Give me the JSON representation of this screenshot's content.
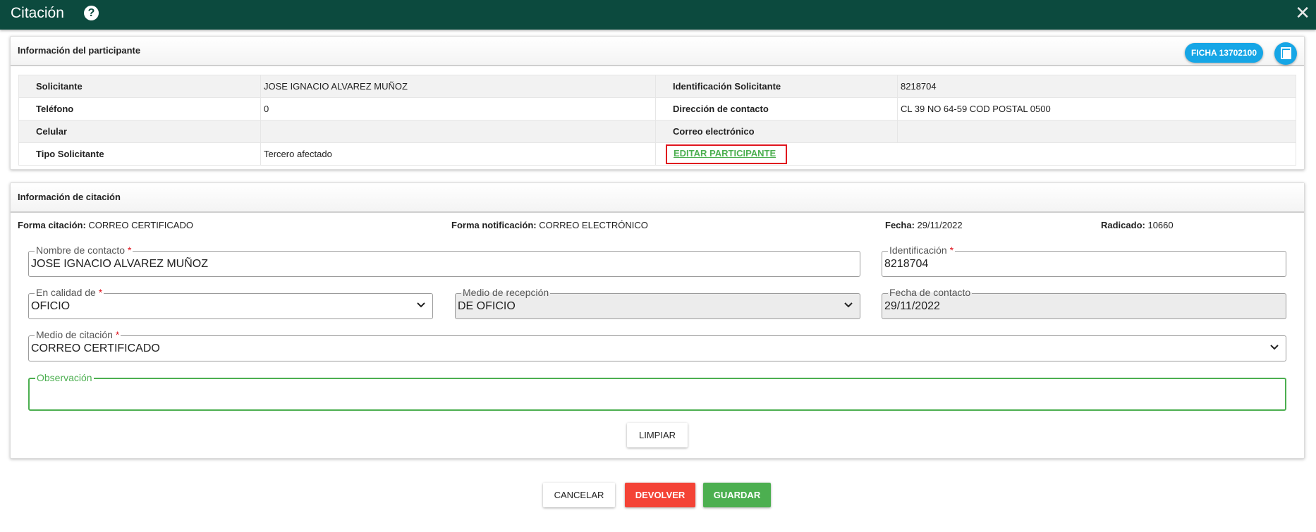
{
  "dialog": {
    "title": "Citación",
    "help_icon": "?",
    "close_icon": "✕"
  },
  "participant": {
    "header": "Información del participante",
    "ficha_label": "FICHA 13702100",
    "rows": [
      {
        "l1": "Solicitante",
        "v1": "JOSE IGNACIO ALVAREZ MUÑOZ",
        "l2": "Identificación Solicitante",
        "v2": "8218704"
      },
      {
        "l1": "Teléfono",
        "v1": "0",
        "l2": "Dirección de contacto",
        "v2": "CL 39 NO 64-59 COD POSTAL 0500"
      },
      {
        "l1": "Celular",
        "v1": "",
        "l2": "Correo electrónico",
        "v2": ""
      },
      {
        "l1": "Tipo Solicitante",
        "v1": "Tercero afectado",
        "link": "EDITAR PARTICIPANTE"
      }
    ]
  },
  "citation": {
    "header": "Información de citación",
    "forma_citacion_label": "Forma citación:",
    "forma_citacion_value": "CORREO CERTIFICADO",
    "forma_notificacion_label": "Forma notificación:",
    "forma_notificacion_value": "CORREO ELECTRÓNICO",
    "fecha_label": "Fecha:",
    "fecha_value": "29/11/2022",
    "radicado_label": "Radicado:",
    "radicado_value": "10660",
    "fields": {
      "nombre_label": "Nombre de contacto",
      "nombre_value": "JOSE IGNACIO ALVAREZ MUÑOZ",
      "identificacion_label": "Identificación",
      "identificacion_value": "8218704",
      "calidad_label": "En calidad de",
      "calidad_value": "OFICIO",
      "medio_recepcion_label": "Medio de recepción",
      "medio_recepcion_value": "DE OFICIO",
      "fecha_contacto_label": "Fecha de contacto",
      "fecha_contacto_value": "29/11/2022",
      "medio_citacion_label": "Medio de citación",
      "medio_citacion_value": "CORREO CERTIFICADO",
      "observacion_label": "Observación",
      "observacion_value": ""
    },
    "required_mark": "*",
    "limpiar_label": "LIMPIAR"
  },
  "footer": {
    "cancelar": "CANCELAR",
    "devolver": "DEVOLVER",
    "guardar": "GUARDAR"
  },
  "colors": {
    "header_bg": "#0c4a3e",
    "accent_blue": "#16a6e6",
    "accent_green": "#4caf50",
    "accent_red": "#f44336"
  }
}
